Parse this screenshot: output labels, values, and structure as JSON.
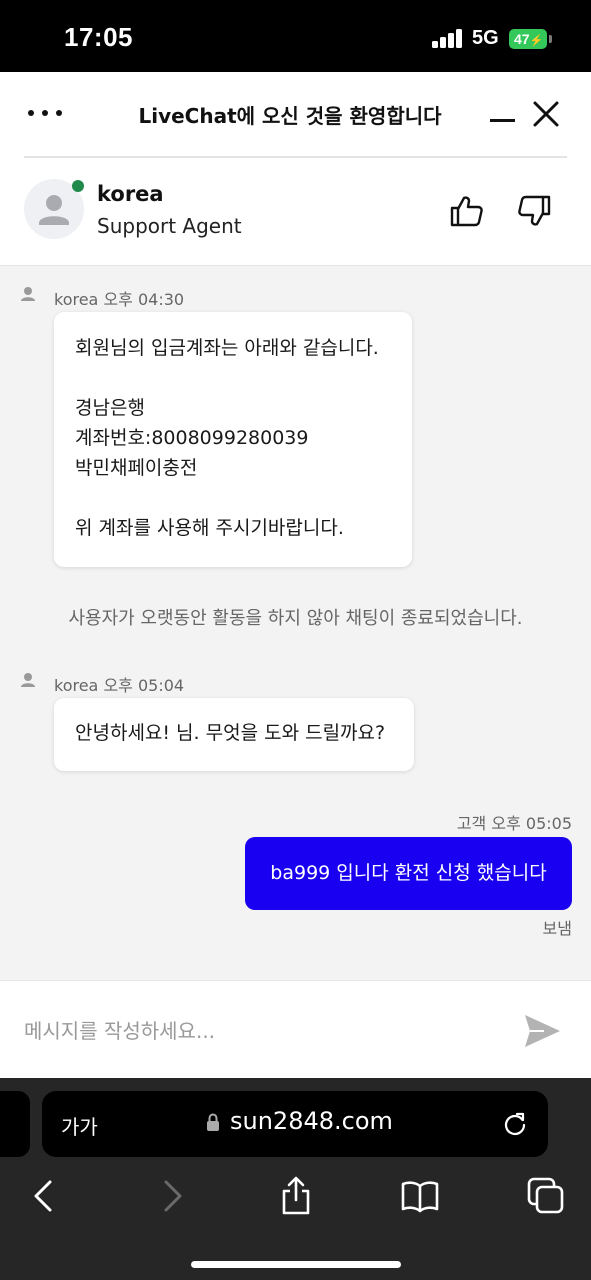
{
  "status_bar": {
    "time": "17:05",
    "network": "5G",
    "battery": "47"
  },
  "header": {
    "title": "LiveChat에 오신 것을 환영합니다",
    "agent": {
      "name": "korea",
      "role": "Support Agent"
    }
  },
  "messages": [
    {
      "sender": "korea",
      "time": "오후 04:30",
      "lines": [
        "회원님의 입금계좌는 아래와 같습니다.",
        "",
        "경남은행",
        "계좌번호:8008099280039",
        "박민채페이충전",
        "",
        "위 계좌를 사용해 주시기바랍니다."
      ]
    },
    {
      "system": "사용자가 오랫동안 활동을 하지 않아 채팅이 종료되었습니다."
    },
    {
      "sender": "korea",
      "time": "오후 05:04",
      "lines": [
        "안녕하세요! 님. 무엇을 도와 드릴까요?"
      ]
    },
    {
      "sender": "고객",
      "time": "오후 05:05",
      "text": "ba999 입니다 환전 신청 했습니다",
      "status": "보냄"
    }
  ],
  "composer": {
    "placeholder": "메시지를 작성하세요..."
  },
  "browser": {
    "text_size_label": "가가",
    "url": "sun2848.com"
  },
  "colors": {
    "outgoing_bubble": "#1a00f0",
    "online": "#1f8a4c",
    "battery": "#34c759"
  }
}
